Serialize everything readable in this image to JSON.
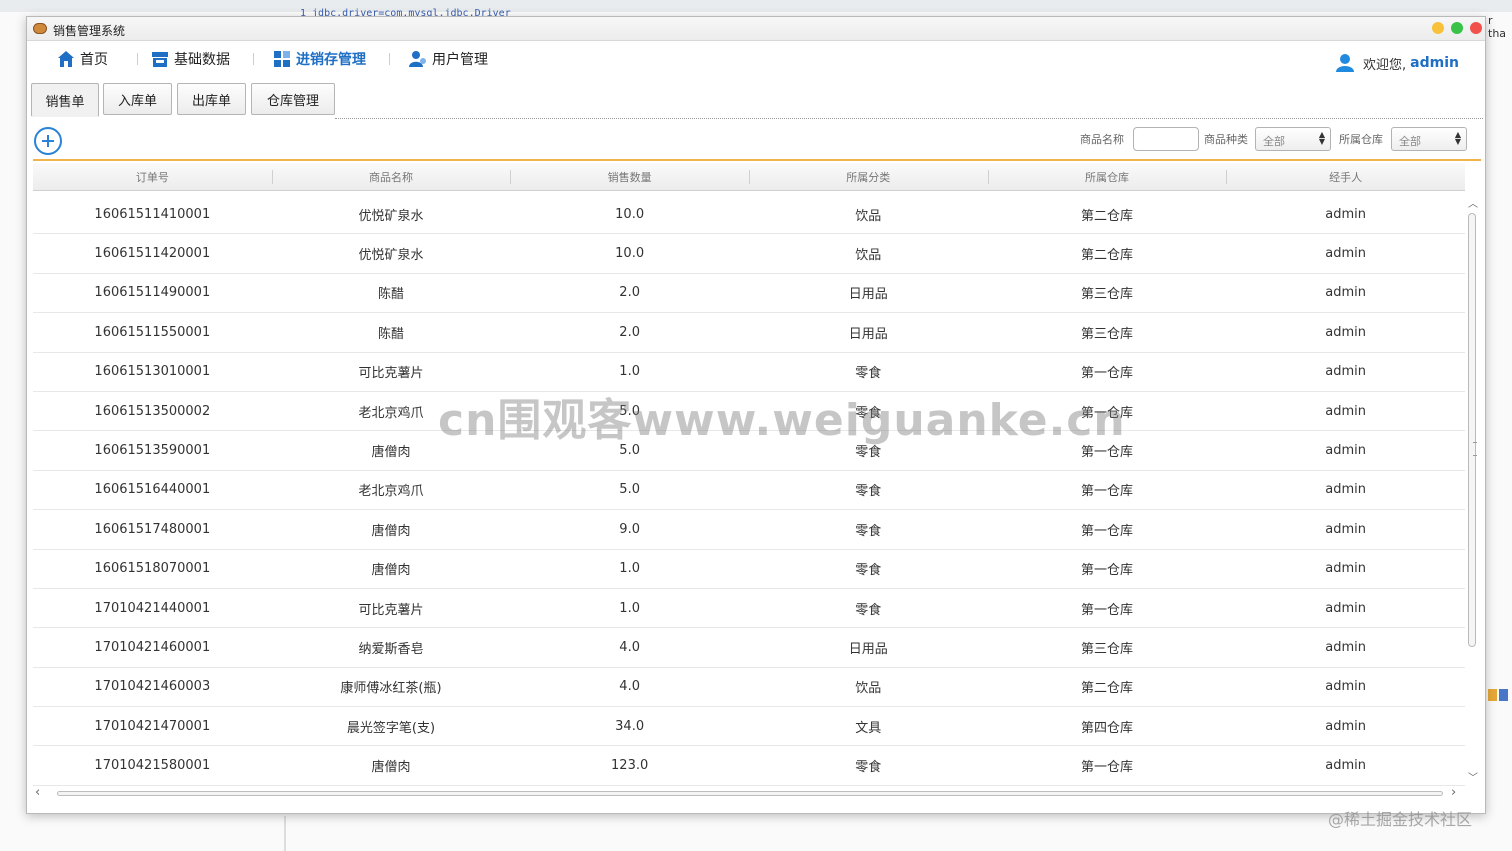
{
  "window": {
    "title": "销售管理系统"
  },
  "nav": {
    "items": [
      {
        "label": "首页",
        "icon": "home-icon"
      },
      {
        "label": "基础数据",
        "icon": "store-icon"
      },
      {
        "label": "进销存管理",
        "icon": "grid-icon",
        "active": true
      },
      {
        "label": "用户管理",
        "icon": "users-icon"
      }
    ],
    "welcome": "欢迎您,",
    "username": "admin"
  },
  "subtabs": [
    {
      "label": "销售单",
      "active": true
    },
    {
      "label": "入库单"
    },
    {
      "label": "出库单"
    },
    {
      "label": "仓库管理"
    }
  ],
  "filters": {
    "name_label": "商品名称",
    "name_value": "",
    "category_label": "商品种类",
    "category_value": "全部",
    "warehouse_label": "所属仓库",
    "warehouse_value": "全部"
  },
  "table": {
    "columns": [
      "订单号",
      "商品名称",
      "销售数量",
      "所属分类",
      "所属仓库",
      "经手人"
    ],
    "rows": [
      [
        "16061511410001",
        "优悦矿泉水",
        "10.0",
        "饮品",
        "第二仓库",
        "admin"
      ],
      [
        "16061511420001",
        "优悦矿泉水",
        "10.0",
        "饮品",
        "第二仓库",
        "admin"
      ],
      [
        "16061511490001",
        "陈醋",
        "2.0",
        "日用品",
        "第三仓库",
        "admin"
      ],
      [
        "16061511550001",
        "陈醋",
        "2.0",
        "日用品",
        "第三仓库",
        "admin"
      ],
      [
        "16061513010001",
        "可比克薯片",
        "1.0",
        "零食",
        "第一仓库",
        "admin"
      ],
      [
        "16061513500002",
        "老北京鸡爪",
        "5.0",
        "零食",
        "第一仓库",
        "admin"
      ],
      [
        "16061513590001",
        "唐僧肉",
        "5.0",
        "零食",
        "第一仓库",
        "admin"
      ],
      [
        "16061516440001",
        "老北京鸡爪",
        "5.0",
        "零食",
        "第一仓库",
        "admin"
      ],
      [
        "16061517480001",
        "唐僧肉",
        "9.0",
        "零食",
        "第一仓库",
        "admin"
      ],
      [
        "16061518070001",
        "唐僧肉",
        "1.0",
        "零食",
        "第一仓库",
        "admin"
      ],
      [
        "17010421440001",
        "可比克薯片",
        "1.0",
        "零食",
        "第一仓库",
        "admin"
      ],
      [
        "17010421460001",
        "纳爱斯香皂",
        "4.0",
        "日用品",
        "第三仓库",
        "admin"
      ],
      [
        "17010421460003",
        "康师傅冰红茶(瓶)",
        "4.0",
        "饮品",
        "第二仓库",
        "admin"
      ],
      [
        "17010421470001",
        "晨光签字笔(支)",
        "34.0",
        "文具",
        "第四仓库",
        "admin"
      ],
      [
        "17010421580001",
        "唐僧肉",
        "123.0",
        "零食",
        "第一仓库",
        "admin"
      ]
    ]
  },
  "background": {
    "code_line": "1 jdbc.driver=com.mysql.jdbc.Driver",
    "right_text": "r tha"
  },
  "overlays": {
    "watermark": "cn围观客www.weiguanke.cn",
    "corner": "@稀土掘金技术社区"
  },
  "colors": {
    "accent": "#1f6fc4",
    "divider": "#f0b44a",
    "add": "#2a82d6"
  }
}
